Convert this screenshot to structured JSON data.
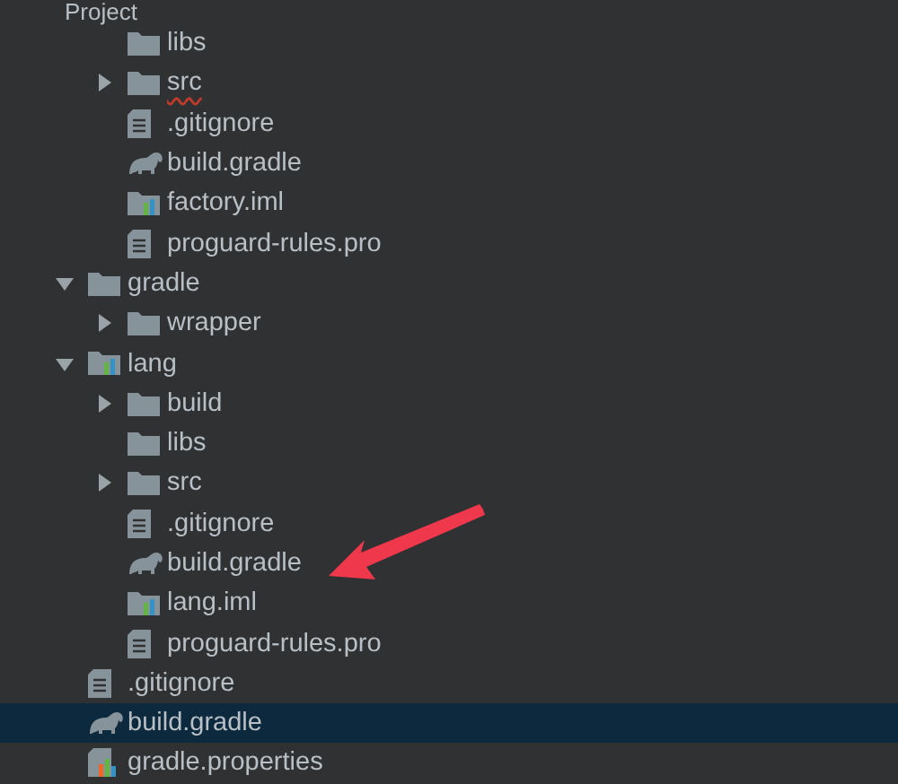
{
  "panel": {
    "title": "Project"
  },
  "tree": [
    {
      "children": [
        {
          "label": "libs",
          "kind": "folder",
          "selected": false,
          "misspelled": false
        },
        {
          "label": "src",
          "kind": "folder",
          "expanded": false,
          "selected": false,
          "misspelled": true
        },
        {
          "label": ".gitignore",
          "kind": "file",
          "selected": false,
          "misspelled": false
        },
        {
          "label": "build.gradle",
          "kind": "gradle",
          "selected": false,
          "misspelled": false
        },
        {
          "label": "factory.iml",
          "kind": "iml",
          "selected": false,
          "misspelled": false
        },
        {
          "label": "proguard-rules.pro",
          "kind": "file",
          "selected": false,
          "misspelled": false
        }
      ]
    },
    {
      "label": "gradle",
      "kind": "folder",
      "expanded": true,
      "selected": false,
      "misspelled": false,
      "children": [
        {
          "label": "wrapper",
          "kind": "folder",
          "expanded": false,
          "selected": false,
          "misspelled": false
        }
      ]
    },
    {
      "label": "lang",
      "kind": "module",
      "expanded": true,
      "selected": false,
      "misspelled": false,
      "children": [
        {
          "label": "build",
          "kind": "folder",
          "expanded": false,
          "selected": false,
          "misspelled": false
        },
        {
          "label": "libs",
          "kind": "folder",
          "selected": false,
          "misspelled": false
        },
        {
          "label": "src",
          "kind": "folder",
          "expanded": false,
          "selected": false,
          "misspelled": false
        },
        {
          "label": ".gitignore",
          "kind": "file",
          "selected": false,
          "misspelled": false
        },
        {
          "label": "build.gradle",
          "kind": "gradle",
          "selected": false,
          "misspelled": false,
          "annotated": true
        },
        {
          "label": "lang.iml",
          "kind": "iml",
          "selected": false,
          "misspelled": false
        },
        {
          "label": "proguard-rules.pro",
          "kind": "file",
          "selected": false,
          "misspelled": false
        }
      ]
    },
    {
      "label": ".gitignore",
      "kind": "file",
      "selected": false,
      "misspelled": false
    },
    {
      "label": "build.gradle",
      "kind": "gradle",
      "selected": true,
      "misspelled": false
    },
    {
      "label": "gradle.properties",
      "kind": "properties",
      "selected": false,
      "misspelled": false
    }
  ]
}
